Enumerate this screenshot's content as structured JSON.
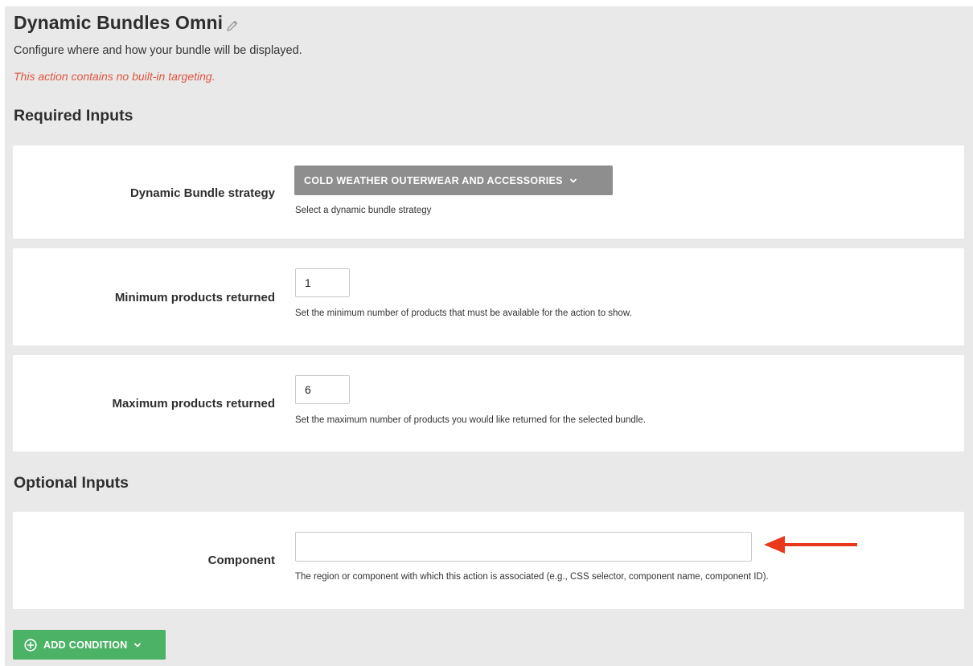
{
  "header": {
    "title": "Dynamic Bundles Omni",
    "subtitle": "Configure where and how your bundle will be displayed.",
    "warning": "This action contains no built-in targeting."
  },
  "required_section": {
    "heading": "Required Inputs",
    "strategy": {
      "label": "Dynamic Bundle strategy",
      "selected": "COLD WEATHER OUTERWEAR AND ACCESSORIES",
      "help": "Select a dynamic bundle strategy"
    },
    "min_products": {
      "label": "Minimum products returned",
      "value": "1",
      "help": "Set the minimum number of products that must be available for the action to show."
    },
    "max_products": {
      "label": "Maximum products returned",
      "value": "6",
      "help": "Set the maximum number of products you would like returned for the selected bundle."
    }
  },
  "optional_section": {
    "heading": "Optional Inputs",
    "component": {
      "label": "Component",
      "value": "",
      "help": "The region or component with which this action is associated (e.g., CSS selector, component name, component ID)."
    }
  },
  "actions": {
    "add_condition": "ADD CONDITION"
  },
  "icons": {
    "edit": "pencil-icon",
    "dropdown": "chevron-down-icon",
    "add": "plus-circle-icon",
    "annotation": "arrow-left-icon"
  },
  "colors": {
    "page_bg": "#e9e9e9",
    "card_bg": "#ffffff",
    "warning": "#e0553f",
    "strategy_button": "#8e8e8e",
    "add_button": "#4cb266",
    "annotation_arrow": "#e8391d"
  }
}
